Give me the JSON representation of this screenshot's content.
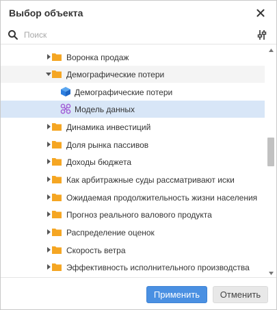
{
  "dialog": {
    "title": "Выбор объекта",
    "close_icon": "close-icon"
  },
  "search": {
    "placeholder": "Поиск",
    "value": "",
    "search_icon": "search-icon",
    "filter_icon": "filter-settings-icon"
  },
  "tree": {
    "items": [
      {
        "label": "Воронка продаж",
        "type": "folder",
        "expanded": false,
        "level": 0
      },
      {
        "label": "Демографические потери",
        "type": "folder",
        "expanded": true,
        "level": 0
      },
      {
        "label": "Демографические потери",
        "type": "cube",
        "level": 1
      },
      {
        "label": "Модель данных",
        "type": "datamodel",
        "level": 1,
        "selected": true
      },
      {
        "label": "Динамика инвестиций",
        "type": "folder",
        "expanded": false,
        "level": 0
      },
      {
        "label": "Доля рынка пассивов",
        "type": "folder",
        "expanded": false,
        "level": 0
      },
      {
        "label": "Доходы бюджета",
        "type": "folder",
        "expanded": false,
        "level": 0
      },
      {
        "label": "Как арбитражные суды рассматривают иски",
        "type": "folder",
        "expanded": false,
        "level": 0
      },
      {
        "label": "Ожидаемая продолжительность жизни населения",
        "type": "folder",
        "expanded": false,
        "level": 0
      },
      {
        "label": "Прогноз реального валового продукта",
        "type": "folder",
        "expanded": false,
        "level": 0
      },
      {
        "label": "Распределение оценок",
        "type": "folder",
        "expanded": false,
        "level": 0
      },
      {
        "label": "Скорость ветра",
        "type": "folder",
        "expanded": false,
        "level": 0
      },
      {
        "label": "Эффективность исполнительного производства",
        "type": "folder",
        "expanded": false,
        "level": 0
      }
    ]
  },
  "footer": {
    "apply_label": "Применить",
    "cancel_label": "Отменить"
  },
  "colors": {
    "folder": "#f5a623",
    "cube": "#2d7fe0",
    "datamodel": "#a35fd6",
    "selected_row": "#d8e6f7",
    "apply_button": "#4a90e2"
  }
}
